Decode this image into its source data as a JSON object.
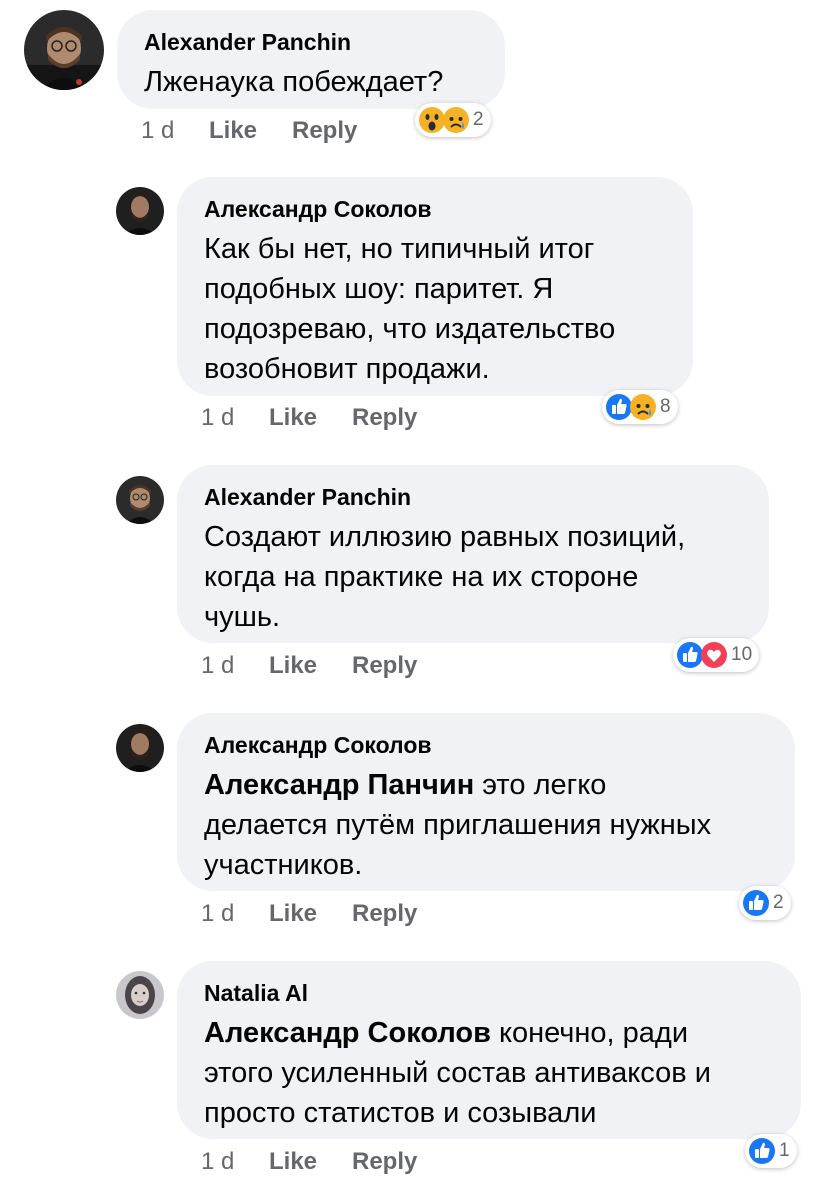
{
  "comments": [
    {
      "author": "Alexander Panchin",
      "mention": "",
      "text_lines": [
        "Лженаука побеждает?"
      ],
      "time": "1 d",
      "like_label": "Like",
      "reply_label": "Reply",
      "reactions": [
        "wow",
        "sad"
      ],
      "reaction_count": "2"
    },
    {
      "author": "Александр Соколов",
      "mention": "",
      "text_lines": [
        "Как бы нет, но типичный итог",
        "подобных шоу:  паритет. Я",
        "подозреваю, что издательство",
        "возобновит продажи."
      ],
      "time": "1 d",
      "like_label": "Like",
      "reply_label": "Reply",
      "reactions": [
        "like",
        "sad"
      ],
      "reaction_count": "8"
    },
    {
      "author": "Alexander Panchin",
      "mention": "",
      "text_lines": [
        "Создают иллюзию равных позиций,",
        "когда на практике на их стороне",
        "чушь."
      ],
      "time": "1 d",
      "like_label": "Like",
      "reply_label": "Reply",
      "reactions": [
        "like",
        "love"
      ],
      "reaction_count": "10"
    },
    {
      "author": "Александр Соколов",
      "mention": "Александр Панчин",
      "text_lines": [
        " это легко",
        "делается путём приглашения нужных",
        "участников."
      ],
      "time": "1 d",
      "like_label": "Like",
      "reply_label": "Reply",
      "reactions": [
        "like"
      ],
      "reaction_count": "2"
    },
    {
      "author": "Natalia Al",
      "mention": "Александр Соколов",
      "text_lines": [
        " конечно, ради",
        "этого усиленный состав антиваксов и",
        "просто статистов и созывали"
      ],
      "time": "1 d",
      "like_label": "Like",
      "reply_label": "Reply",
      "reactions": [
        "like"
      ],
      "reaction_count": "1"
    }
  ],
  "colors": {
    "bubble": "#f0f2f5",
    "meta_text": "#65676b",
    "like_blue": "#1877f2",
    "love_red": "#f33e58",
    "emoji_yellow": "#f7b125"
  }
}
